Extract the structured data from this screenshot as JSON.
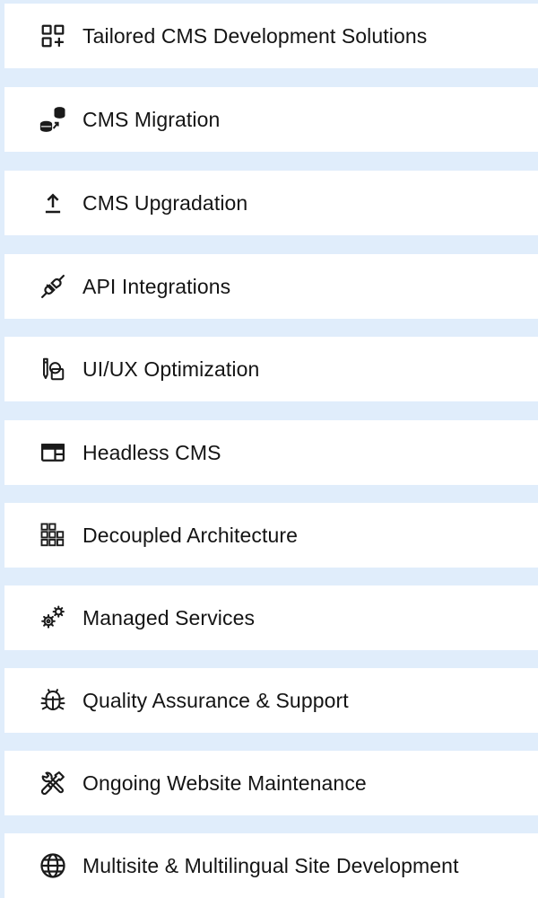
{
  "colors": {
    "background": "#e0edfb",
    "card": "#ffffff",
    "text": "#141414",
    "icon": "#1a1a1a"
  },
  "services": [
    {
      "label": "Tailored CMS Development Solutions",
      "icon": "grid-plus-icon"
    },
    {
      "label": "CMS Migration",
      "icon": "database-migration-icon"
    },
    {
      "label": "CMS Upgradation",
      "icon": "upload-arrow-icon"
    },
    {
      "label": "API Integrations",
      "icon": "plug-icon"
    },
    {
      "label": "UI/UX Optimization",
      "icon": "design-tools-icon"
    },
    {
      "label": "Headless CMS",
      "icon": "browser-layout-icon"
    },
    {
      "label": "Decoupled Architecture",
      "icon": "blocks-icon"
    },
    {
      "label": "Managed Services",
      "icon": "gears-icon"
    },
    {
      "label": "Quality Assurance & Support",
      "icon": "bug-icon"
    },
    {
      "label": "Ongoing Website Maintenance",
      "icon": "tools-icon"
    },
    {
      "label": "Multisite & Multilingual Site Development",
      "icon": "globe-icon"
    }
  ]
}
